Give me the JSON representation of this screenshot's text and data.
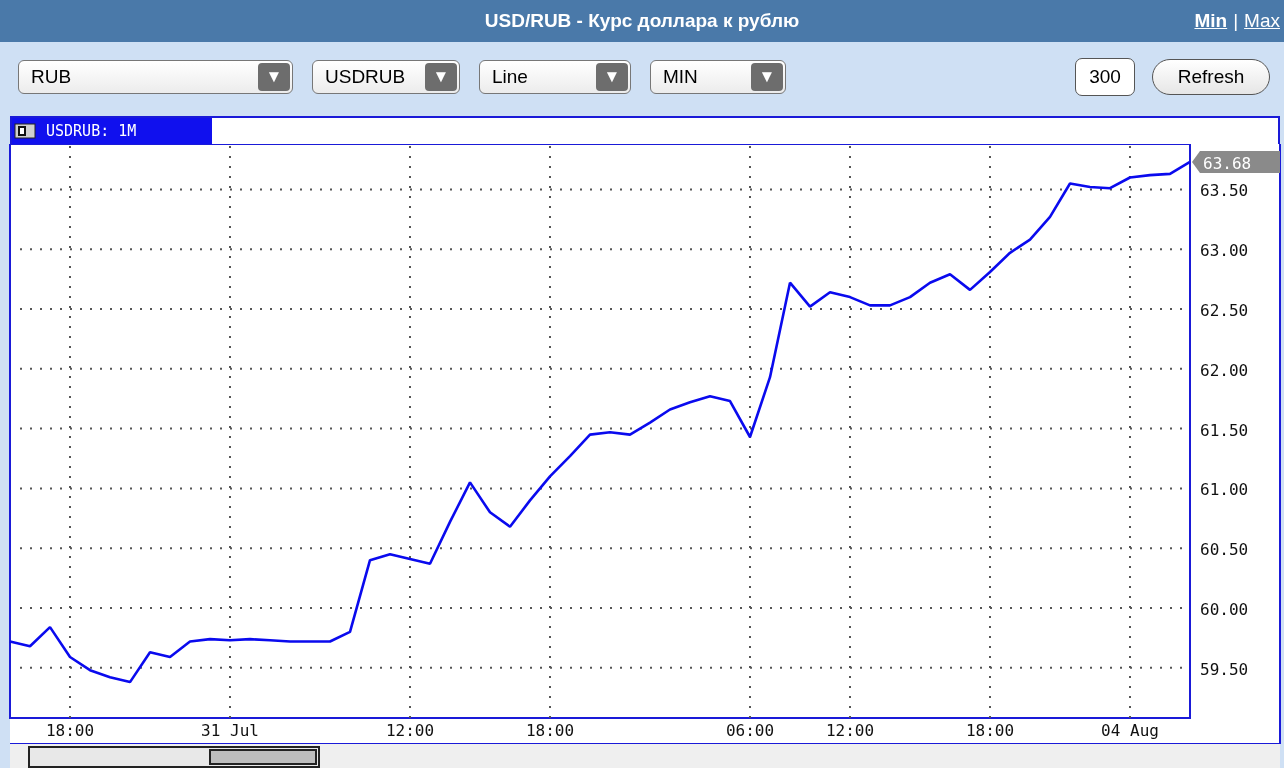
{
  "window": {
    "title": "USD/RUB - Курс доллара к рублю"
  },
  "view_links": [
    {
      "label": "Min",
      "selected": true
    },
    {
      "label": "Max",
      "selected": false
    }
  ],
  "separator": "|",
  "toolbar": {
    "selects": [
      {
        "value": "RUB",
        "arrow": "▼"
      },
      {
        "value": "USDRUB",
        "arrow": "▼"
      },
      {
        "value": "Line",
        "arrow": "▼"
      },
      {
        "value": "MIN",
        "arrow": "▼"
      }
    ],
    "count_field": {
      "value": "300"
    },
    "refresh_button": "Refresh"
  },
  "chart": {
    "last_price": "63.68",
    "chart_data": {
      "type": "line",
      "categories": [
        null,
        null,
        null,
        "18:00",
        null,
        null,
        null,
        null,
        null,
        null,
        null,
        "31 Jul",
        null,
        null,
        null,
        null,
        null,
        null,
        null,
        null,
        "12:00",
        null,
        null,
        null,
        null,
        null,
        null,
        "18:00",
        null,
        null,
        null,
        null,
        null,
        null,
        null,
        null,
        null,
        "06:00",
        null,
        null,
        null,
        null,
        "12:00",
        null,
        null,
        null,
        null,
        null,
        null,
        "18:00",
        null,
        null,
        null,
        null,
        null,
        null,
        "04 Aug",
        null,
        null,
        null
      ],
      "grid": true,
      "series": [
        {
          "name": "USDRUB: 1M",
          "color": "#0a0aee",
          "values": [
            59.72,
            59.68,
            59.84,
            59.59,
            59.48,
            59.42,
            59.38,
            59.63,
            59.59,
            59.72,
            59.74,
            59.73,
            59.74,
            59.73,
            59.72,
            59.72,
            59.72,
            59.8,
            60.4,
            60.45,
            60.41,
            60.37,
            60.72,
            61.05,
            60.8,
            60.68,
            60.9,
            61.1,
            61.27,
            61.45,
            61.47,
            61.45,
            61.55,
            61.66,
            61.72,
            61.77,
            61.73,
            61.43,
            61.93,
            62.72,
            62.52,
            62.64,
            62.6,
            62.53,
            62.53,
            62.6,
            62.72,
            62.79,
            62.66,
            62.81,
            62.97,
            63.08,
            63.27,
            63.55,
            63.52,
            63.51,
            63.6,
            63.62,
            63.63,
            63.73
          ]
        }
      ],
      "ylim": [
        59.08,
        63.88
      ],
      "yticks": [
        {
          "value": 59.5,
          "label": "59.50"
        },
        {
          "value": 60,
          "label": "60.00"
        },
        {
          "value": 60.5,
          "label": "60.50"
        },
        {
          "value": 61,
          "label": "61.00"
        },
        {
          "value": 61.5,
          "label": "61.50"
        },
        {
          "value": 62,
          "label": "62.00"
        },
        {
          "value": 62.5,
          "label": "62.50"
        },
        {
          "value": 63,
          "label": "63.00"
        },
        {
          "value": 63.5,
          "label": "63.50"
        }
      ]
    }
  }
}
